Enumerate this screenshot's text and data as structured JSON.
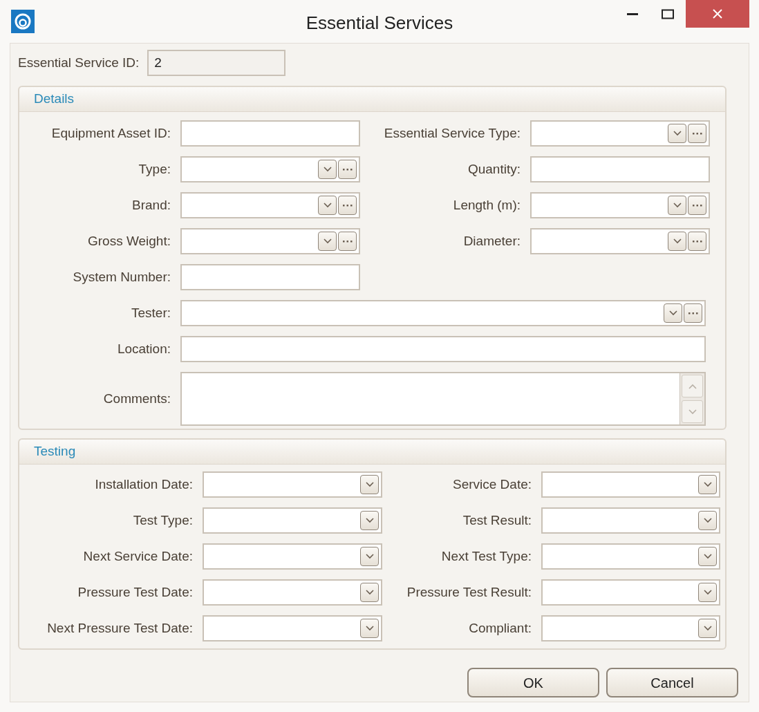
{
  "window": {
    "title": "Essential Services"
  },
  "id_field": {
    "label": "Essential Service ID:",
    "value": "2"
  },
  "details": {
    "title": "Details",
    "rows": [
      {
        "left": {
          "label": "Equipment Asset ID:",
          "kind": "text"
        },
        "right": {
          "label": "Essential Service Type:",
          "kind": "combo"
        }
      },
      {
        "left": {
          "label": "Type:",
          "kind": "combo"
        },
        "right": {
          "label": "Quantity:",
          "kind": "text"
        }
      },
      {
        "left": {
          "label": "Brand:",
          "kind": "combo"
        },
        "right": {
          "label": "Length (m):",
          "kind": "combo"
        }
      },
      {
        "left": {
          "label": "Gross Weight:",
          "kind": "combo"
        },
        "right": {
          "label": "Diameter:",
          "kind": "combo"
        }
      },
      {
        "left": {
          "label": "System Number:",
          "kind": "text"
        }
      }
    ],
    "wide_fields": [
      {
        "label": "Tester:",
        "kind": "combo"
      },
      {
        "label": "Location:",
        "kind": "text"
      },
      {
        "label": "Comments:",
        "kind": "memo"
      }
    ]
  },
  "testing": {
    "title": "Testing",
    "rows": [
      {
        "left": {
          "label": "Installation Date:",
          "kind": "dropdown"
        },
        "right": {
          "label": "Service Date:",
          "kind": "dropdown"
        }
      },
      {
        "left": {
          "label": "Test Type:",
          "kind": "dropdown"
        },
        "right": {
          "label": "Test Result:",
          "kind": "dropdown"
        }
      },
      {
        "left": {
          "label": "Next Service Date:",
          "kind": "dropdown"
        },
        "right": {
          "label": "Next Test Type:",
          "kind": "dropdown"
        }
      },
      {
        "left": {
          "label": "Pressure Test Date:",
          "kind": "dropdown"
        },
        "right": {
          "label": "Pressure Test Result:",
          "kind": "dropdown"
        }
      },
      {
        "left": {
          "label": "Next Pressure Test Date:",
          "kind": "dropdown"
        },
        "right": {
          "label": "Compliant:",
          "kind": "dropdown"
        }
      }
    ]
  },
  "buttons": [
    "OK",
    "Cancel"
  ]
}
